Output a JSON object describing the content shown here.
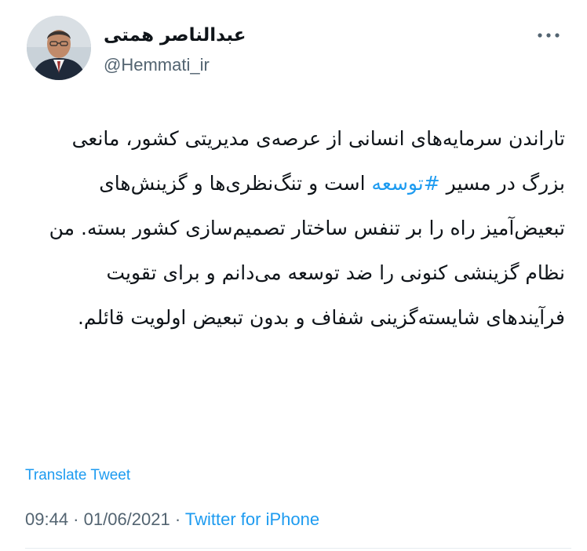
{
  "author": {
    "display_name": "عبدالناصر همتی",
    "handle": "@Hemmati_ir"
  },
  "more_icon": "more-horizontal-icon",
  "tweet": {
    "text_before": "تاراندن سرمایه‌های انسانی از عرصه‌ی مدیریتی کشور، مانعی بزرگ در مسیر ",
    "hashtag": "#توسعه",
    "text_after": " است و تنگ‌نظری‌ها و گزینش‌های تبعیض‌آمیز راه را بر تنفس ساختار تصمیم‌سازی کشور بسته. من نظام گزینشی کنونی را ضد توسعه می‌دانم و برای تقویت فرآیندهای شایسته‌گزینی شفاف و بدون تبعیض اولویت قائلم."
  },
  "translate_label": "Translate Tweet",
  "meta": {
    "time": "09:44",
    "separator1": " · ",
    "date": "01/06/2021",
    "separator2": " · ",
    "source": "Twitter for iPhone"
  },
  "colors": {
    "link": "#1d9bf0",
    "secondary_text": "#536471",
    "primary_text": "#0f1419"
  }
}
